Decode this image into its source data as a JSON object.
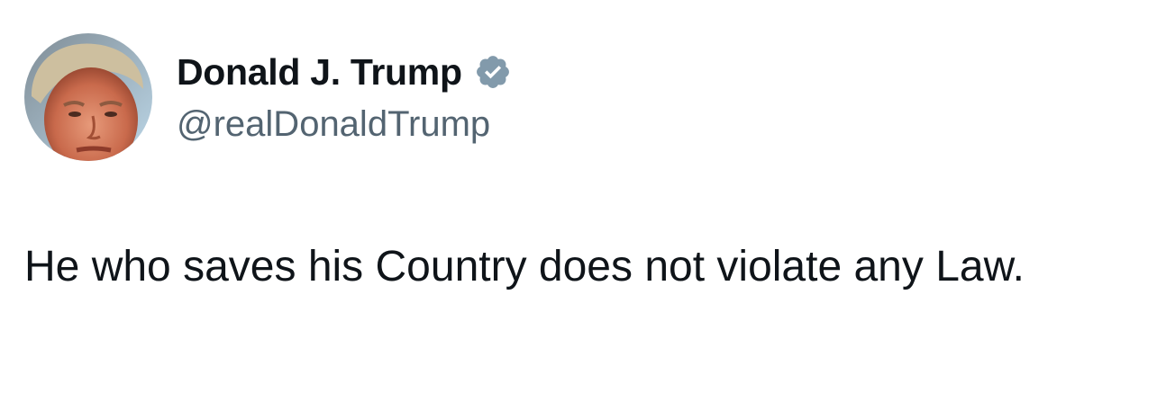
{
  "author": {
    "display_name": "Donald J. Trump",
    "handle": "@realDonaldTrump",
    "verified": true
  },
  "tweet": {
    "text": "He who saves his Country does not violate any Law."
  },
  "colors": {
    "text_primary": "#0f1419",
    "text_secondary": "#536471",
    "badge": "#829aab",
    "background": "#ffffff"
  },
  "icons": {
    "avatar": "profile-photo",
    "badge": "verified-badge-icon"
  }
}
